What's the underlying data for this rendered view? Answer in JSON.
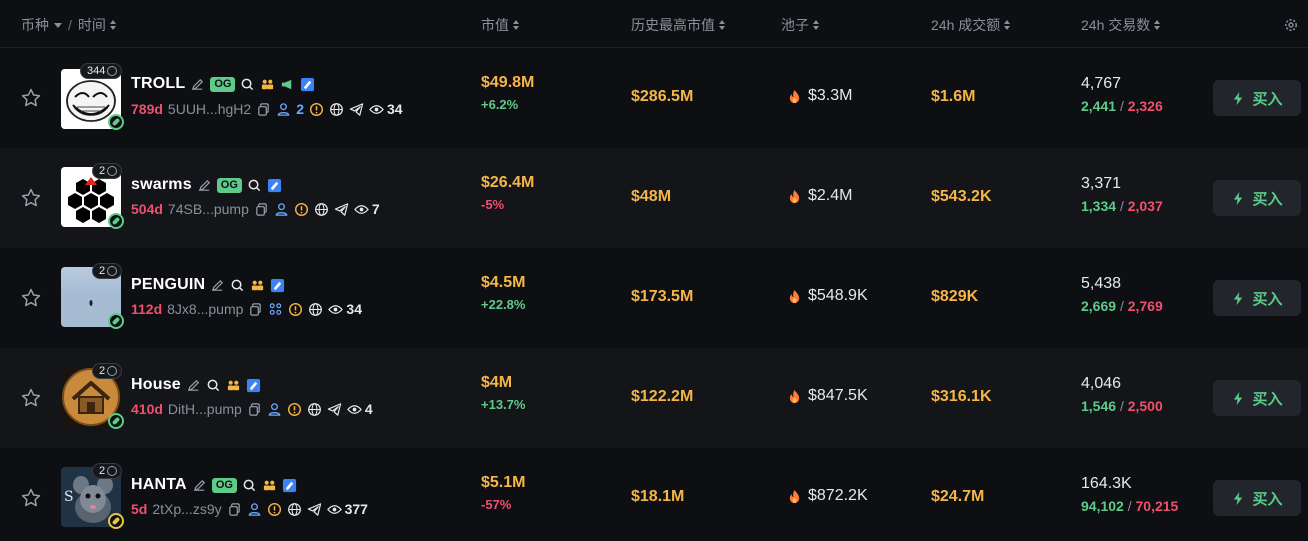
{
  "header": {
    "coin": "币种",
    "sep": "/",
    "time": "时间",
    "market_cap": "市值",
    "ath_market_cap": "历史最高市值",
    "pool": "池子",
    "volume_24h": "24h 成交额",
    "txns_24h": "24h 交易数",
    "settings_icon": "gear-icon"
  },
  "buy_label": "买入",
  "colors": {
    "accent_green": "#5ecb8a",
    "accent_red": "#f0506e",
    "accent_gold": "#f5b547",
    "background": "#0e0f12"
  },
  "rows": [
    {
      "symbol": "TROLL",
      "og": "OG",
      "holders": "344",
      "age": "789d",
      "address": "5UUH...hgH2",
      "holders_icon_count": "2",
      "views": "34",
      "market_cap": "$49.8M",
      "change": "+6.2%",
      "ath": "$286.5M",
      "pool": "$3.3M",
      "volume": "$1.6M",
      "txns": "4,767",
      "buys": "2,441",
      "sells": "2,326",
      "slash": "/"
    },
    {
      "symbol": "swarms",
      "og": "OG",
      "holders": "2",
      "age": "504d",
      "address": "74SB...pump",
      "views": "7",
      "market_cap": "$26.4M",
      "change": "-5%",
      "ath": "$48M",
      "pool": "$2.4M",
      "volume": "$543.2K",
      "txns": "3,371",
      "buys": "1,334",
      "sells": "2,037",
      "slash": "/"
    },
    {
      "symbol": "PENGUIN",
      "holders": "2",
      "age": "112d",
      "address": "8Jx8...pump",
      "views": "34",
      "market_cap": "$4.5M",
      "change": "+22.8%",
      "ath": "$173.5M",
      "pool": "$548.9K",
      "volume": "$829K",
      "txns": "5,438",
      "buys": "2,669",
      "sells": "2,769",
      "slash": "/"
    },
    {
      "symbol": "House",
      "holders": "2",
      "age": "410d",
      "address": "DitH...pump",
      "views": "4",
      "market_cap": "$4M",
      "change": "+13.7%",
      "ath": "$122.2M",
      "pool": "$847.5K",
      "volume": "$316.1K",
      "txns": "4,046",
      "buys": "1,546",
      "sells": "2,500",
      "slash": "/"
    },
    {
      "symbol": "HANTA",
      "og": "OG",
      "holders": "2",
      "age": "5d",
      "address": "2tXp...zs9y",
      "views": "377",
      "market_cap": "$5.1M",
      "change": "-57%",
      "ath": "$18.1M",
      "pool": "$872.2K",
      "volume": "$24.7M",
      "txns": "164.3K",
      "buys": "94,102",
      "sells": "70,215",
      "slash": "/"
    }
  ]
}
